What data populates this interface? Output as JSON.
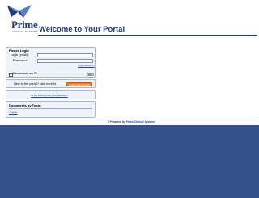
{
  "brand": {
    "name": "Prime",
    "subtitle": "CLINICAL SYSTEMS",
    "primary_color": "#1f3c78",
    "background_color": "#34508c"
  },
  "header": {
    "title": "Welcome to Your Portal"
  },
  "login": {
    "heading": "Please Login",
    "email_label": "Login (email):",
    "email_value": "",
    "password_label": "Password:",
    "password_value": "",
    "forgot_link": "Forgot password?",
    "remember_label": "Remember my ID",
    "remember_checked": false,
    "signin_button": "Sign in"
  },
  "register": {
    "prompt": "New to the portal? click here to",
    "button_label": "Create New Account",
    "button_color": "#f07d2b"
  },
  "reset": {
    "link_text": "To the Online enter your password"
  },
  "documents": {
    "heading": "Documents by Topic:",
    "items": [
      {
        "label": "Public"
      }
    ]
  },
  "footer": {
    "prefix": "© Powered by",
    "brand": "Prime Clinical Systems"
  }
}
